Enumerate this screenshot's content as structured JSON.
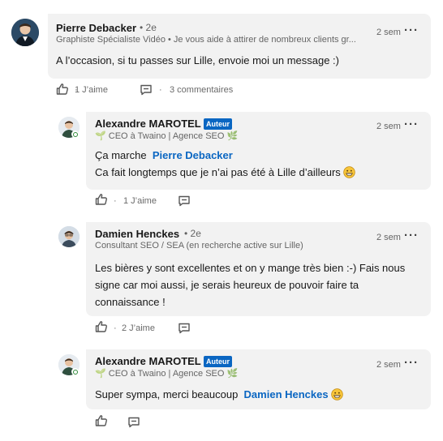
{
  "comment": {
    "author": "Pierre Debacker",
    "degree": "• 2e",
    "headline": "Graphiste Spécialiste Vidéo • Je vous aide à attirer de nombreux clients gr...",
    "time": "2 sem",
    "text": "A l’occasion, si tu passes sur Lille, envoie moi un message :)",
    "likes": "1 J’aime",
    "comments": "3 commentaires"
  },
  "replies": [
    {
      "author": "Alexandre MAROTEL",
      "badge": "Auteur",
      "headline": "CEO à Twaino | Agence SEO",
      "time": "2 sem",
      "text_before": "Ça marche",
      "mention": "Pierre Debacker",
      "text_line2": "Ca fait longtemps que je n’ai pas été à Lille d’ailleurs",
      "likes": "1 J’aime"
    },
    {
      "author": "Damien Henckes",
      "degree": "• 2e",
      "headline": "Consultant SEO / SEA (en recherche active sur Lille)",
      "time": "2 sem",
      "text": "Les bières y sont excellentes et on y mange très bien :-) Fais nous signe car moi aussi, je serais heureux de pouvoir faire ta connaissance !",
      "likes": "2 J’aime"
    },
    {
      "author": "Alexandre MAROTEL",
      "badge": "Auteur",
      "headline": "CEO à Twaino | Agence SEO",
      "time": "2 sem",
      "text_before": "Super sympa, merci beaucoup",
      "mention": "Damien Henckes"
    }
  ],
  "icons": {
    "like": "thumbs-up-icon",
    "reply": "speech-bubble-icon",
    "more": "ellipsis-icon",
    "emoji": "grinning-face-emoji",
    "plant": "sprout-emoji",
    "leaf": "leaf-emoji"
  },
  "colors": {
    "bubble": "#f2f2f2",
    "mention": "#0a66c2",
    "badge": "#0a66c2",
    "online": "#2f8a3a"
  }
}
